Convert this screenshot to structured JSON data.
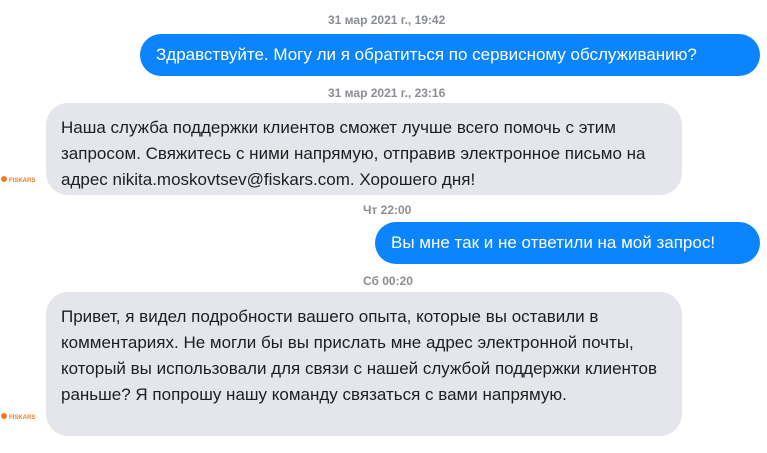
{
  "messages": [
    {
      "timestamp": "31 мар 2021 г., 19:42",
      "direction": "outgoing",
      "text": "Здравствуйте. Могу ли я обратиться по сервисному обслуживанию?"
    },
    {
      "timestamp": "31 мар 2021 г., 23:16",
      "direction": "incoming",
      "text": "Наша служба поддержки клиентов сможет лучше всего помочь с этим запросом. Свяжитесь с ними напрямую, отправив электронное письмо на адрес nikita.moskovtsev@fiskars.com. Хорошего дня!"
    },
    {
      "timestamp": "Чт 22:00",
      "direction": "outgoing",
      "text": "Вы мне так и не ответили на мой запрос!"
    },
    {
      "timestamp": "Сб 00:20",
      "direction": "incoming",
      "text": "Привет, я видел подробности вашего опыта, которые вы оставили в комментариях. Не могли бы вы прислать мне адрес электронной почты, который вы использовали для связи с нашей службой поддержки клиентов раньше? Я попрошу нашу команду связаться с вами напрямую."
    }
  ],
  "sender_avatar": {
    "icon": "fiskars-logo-icon",
    "label": "FISKARS",
    "color": "#f47b20"
  },
  "colors": {
    "outgoing_bubble": "#0a84ff",
    "incoming_bubble": "#e4e6eb",
    "timestamp": "#8a8d91"
  }
}
